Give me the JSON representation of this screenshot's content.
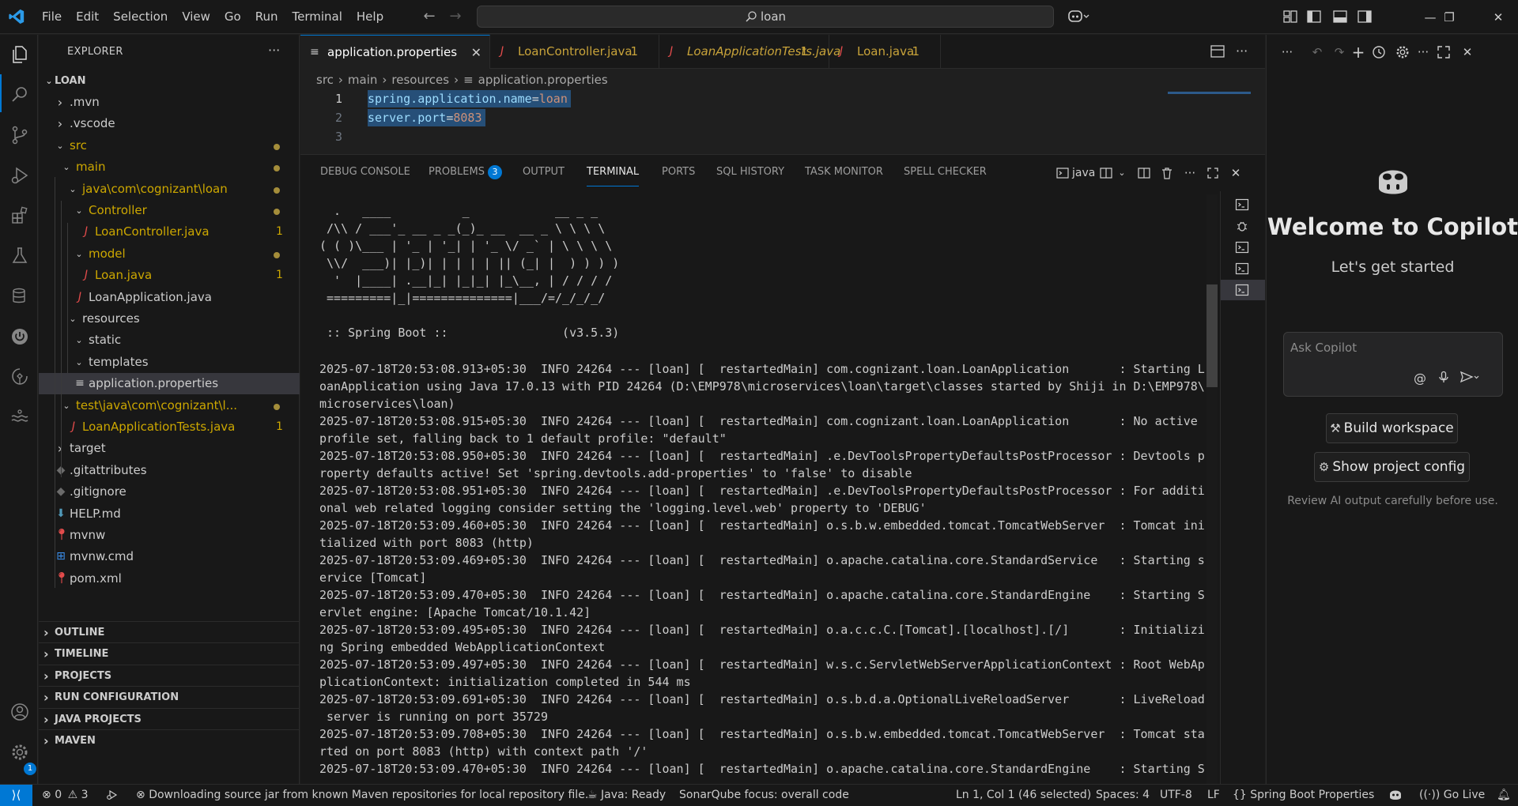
{
  "menu": [
    "File",
    "Edit",
    "Selection",
    "View",
    "Go",
    "Run",
    "Terminal",
    "Help"
  ],
  "command_center": {
    "text": "loan"
  },
  "explorer": {
    "title": "EXPLORER",
    "root": "LOAN",
    "tree": [
      {
        "label": ".mvn",
        "depth": 1,
        "kind": "folder-collapsed"
      },
      {
        "label": ".vscode",
        "depth": 1,
        "kind": "folder-collapsed"
      },
      {
        "label": "src",
        "depth": 1,
        "kind": "folder-open",
        "modified": true
      },
      {
        "label": "main",
        "depth": 2,
        "kind": "folder-open",
        "modified": true
      },
      {
        "label": "java\\com\\cognizant\\loan",
        "depth": 3,
        "kind": "folder-open",
        "modified": true
      },
      {
        "label": "Controller",
        "depth": 4,
        "kind": "folder-open",
        "modified": true
      },
      {
        "label": "LoanController.java",
        "depth": 5,
        "kind": "java",
        "errors": "1"
      },
      {
        "label": "model",
        "depth": 4,
        "kind": "folder-open",
        "modified": true
      },
      {
        "label": "Loan.java",
        "depth": 5,
        "kind": "java",
        "errors": "1"
      },
      {
        "label": "LoanApplication.java",
        "depth": 4,
        "kind": "java-plain"
      },
      {
        "label": "resources",
        "depth": 3,
        "kind": "folder-open"
      },
      {
        "label": "static",
        "depth": 4,
        "kind": "folder-open"
      },
      {
        "label": "templates",
        "depth": 4,
        "kind": "folder-open"
      },
      {
        "label": "application.properties",
        "depth": 4,
        "kind": "props",
        "selected": true
      },
      {
        "label": "test\\java\\com\\cognizant\\l...",
        "depth": 2,
        "kind": "folder-open",
        "modified": true
      },
      {
        "label": "LoanApplicationTests.java",
        "depth": 3,
        "kind": "java",
        "errors": "1"
      },
      {
        "label": "target",
        "depth": 1,
        "kind": "folder-collapsed"
      },
      {
        "label": ".gitattributes",
        "depth": 1,
        "kind": "git"
      },
      {
        "label": ".gitignore",
        "depth": 1,
        "kind": "git"
      },
      {
        "label": "HELP.md",
        "depth": 1,
        "kind": "md"
      },
      {
        "label": "mvnw",
        "depth": 1,
        "kind": "mvn"
      },
      {
        "label": "mvnw.cmd",
        "depth": 1,
        "kind": "win"
      },
      {
        "label": "pom.xml",
        "depth": 1,
        "kind": "mvn"
      }
    ],
    "sections": [
      "OUTLINE",
      "TIMELINE",
      "PROJECTS",
      "RUN CONFIGURATION",
      "JAVA PROJECTS",
      "MAVEN"
    ]
  },
  "tabs": [
    {
      "label": "application.properties",
      "active": true,
      "kind": "props"
    },
    {
      "label": "LoanController.java",
      "count": "1",
      "kind": "java"
    },
    {
      "label": "LoanApplicationTests.java",
      "count": "1",
      "kind": "java",
      "italic": true
    },
    {
      "label": "Loan.java",
      "count": "1",
      "kind": "java"
    }
  ],
  "breadcrumb": [
    "src",
    "main",
    "resources",
    "application.properties"
  ],
  "code": [
    {
      "num": "1",
      "key": "spring.application.name",
      "value": "loan"
    },
    {
      "num": "2",
      "key": "server.port",
      "value": "8083"
    },
    {
      "num": "3",
      "key": "",
      "value": ""
    }
  ],
  "panel_tabs": [
    "DEBUG CONSOLE",
    "PROBLEMS",
    "OUTPUT",
    "TERMINAL",
    "PORTS",
    "SQL HISTORY",
    "TASK MONITOR",
    "SPELL CHECKER"
  ],
  "problems_count": "3",
  "terminal_profile": "java",
  "terminal_lines": [
    "",
    "  .   ____          _            __ _ _",
    " /\\\\ / ___'_ __ _ _(_)_ __  __ _ \\ \\ \\ \\",
    "( ( )\\___ | '_ | '_| | '_ \\/ _` | \\ \\ \\ \\",
    " \\\\/  ___)| |_)| | | | | || (_| |  ) ) ) )",
    "  '  |____| .__|_| |_|_| |_\\__, | / / / /",
    " =========|_|==============|___/=/_/_/_/",
    "",
    " :: Spring Boot ::                (v3.5.3)",
    "",
    "2025-07-18T20:53:08.913+05:30  INFO 24264 --- [loan] [  restartedMain] com.cognizant.loan.LoanApplication       : Starting L",
    "oanApplication using Java 17.0.13 with PID 24264 (D:\\EMP978\\microservices\\loan\\target\\classes started by Shiji in D:\\EMP978\\",
    "microservices\\loan)",
    "2025-07-18T20:53:08.915+05:30  INFO 24264 --- [loan] [  restartedMain] com.cognizant.loan.LoanApplication       : No active ",
    "profile set, falling back to 1 default profile: \"default\"",
    "2025-07-18T20:53:08.950+05:30  INFO 24264 --- [loan] [  restartedMain] .e.DevToolsPropertyDefaultsPostProcessor : Devtools p",
    "roperty defaults active! Set 'spring.devtools.add-properties' to 'false' to disable",
    "2025-07-18T20:53:08.951+05:30  INFO 24264 --- [loan] [  restartedMain] .e.DevToolsPropertyDefaultsPostProcessor : For additi",
    "onal web related logging consider setting the 'logging.level.web' property to 'DEBUG'",
    "2025-07-18T20:53:09.460+05:30  INFO 24264 --- [loan] [  restartedMain] o.s.b.w.embedded.tomcat.TomcatWebServer  : Tomcat ini",
    "tialized with port 8083 (http)",
    "2025-07-18T20:53:09.469+05:30  INFO 24264 --- [loan] [  restartedMain] o.apache.catalina.core.StandardService   : Starting s",
    "ervice [Tomcat]",
    "2025-07-18T20:53:09.470+05:30  INFO 24264 --- [loan] [  restartedMain] o.apache.catalina.core.StandardEngine    : Starting S",
    "ervlet engine: [Apache Tomcat/10.1.42]",
    "2025-07-18T20:53:09.495+05:30  INFO 24264 --- [loan] [  restartedMain] o.a.c.c.C.[Tomcat].[localhost].[/]       : Initializi",
    "ng Spring embedded WebApplicationContext",
    "2025-07-18T20:53:09.497+05:30  INFO 24264 --- [loan] [  restartedMain] w.s.c.ServletWebServerApplicationContext : Root WebAp",
    "plicationContext: initialization completed in 544 ms",
    "2025-07-18T20:53:09.691+05:30  INFO 24264 --- [loan] [  restartedMain] o.s.b.d.a.OptionalLiveReloadServer       : LiveReload",
    " server is running on port 35729",
    "2025-07-18T20:53:09.708+05:30  INFO 24264 --- [loan] [  restartedMain] o.s.b.w.embedded.tomcat.TomcatWebServer  : Tomcat sta",
    "rted on port 8083 (http) with context path '/'",
    "2025-07-18T20:53:09.470+05:30  INFO 24264 --- [loan] [  restartedMain] o.apache.catalina.core.StandardEngine    : Starting S"
  ],
  "copilot": {
    "title": "Welcome to Copilot",
    "subtitle": "Let's get started",
    "placeholder": "Ask Copilot",
    "build_button": "Build workspace",
    "config_button": "Show project config",
    "note": "Review AI output carefully before use."
  },
  "status": {
    "errors": "0",
    "warnings": "3",
    "message": "Downloading source jar from known Maven repositories for local repository file.",
    "java": "Java: Ready",
    "sonar": "SonarQube focus: overall code",
    "position": "Ln 1, Col 1 (46 selected)",
    "spaces": "Spaces: 4",
    "encoding": "UTF-8",
    "eol": "LF",
    "language": "Spring Boot Properties",
    "golive": "Go Live"
  },
  "accounts_badge": "1",
  "colors": {
    "accent": "#0078d4",
    "warning": "#cca700",
    "error": "#e24b4b",
    "selection": "#264f78"
  }
}
